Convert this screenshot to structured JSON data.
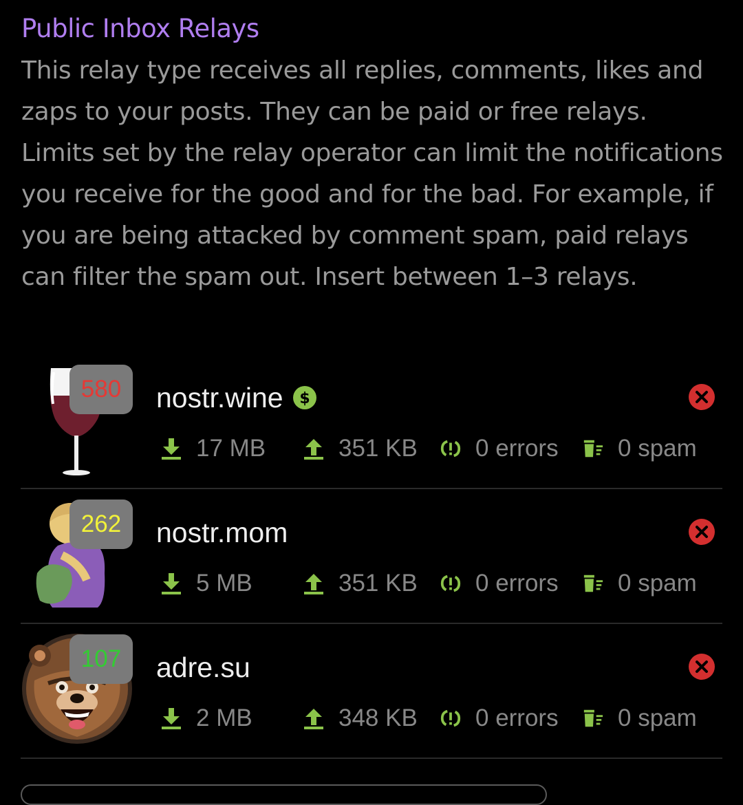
{
  "section": {
    "title": "Public Inbox Relays",
    "description": "This relay type receives all replies, comments, likes and zaps to your posts. They can be paid or free relays. Limits set by the relay operator can limit the notifications you receive for the good and for the bad. For example, if you are being attacked by comment spam, paid relays can filter the spam out. Insert between 1–3 relays."
  },
  "colors": {
    "title": "#b07ef0",
    "accent_green": "#8bc34a",
    "remove_red": "#d32f2f"
  },
  "relays": [
    {
      "name": "nostr.wine",
      "count": "580",
      "count_color": "#e53935",
      "paid": true,
      "paid_icon": "dollar-icon",
      "avatar_icon": "wine-glass-icon",
      "download": "17 MB",
      "upload": "351 KB",
      "errors": "0 errors",
      "spam": "0 spam"
    },
    {
      "name": "nostr.mom",
      "count": "262",
      "count_color": "#f2f23a",
      "paid": false,
      "avatar_icon": "mother-avatar-icon",
      "download": "5 MB",
      "upload": "351 KB",
      "errors": "0 errors",
      "spam": "0 spam"
    },
    {
      "name": "adre.su",
      "count": "107",
      "count_color": "#33cc33",
      "paid": false,
      "avatar_icon": "bear-avatar-icon",
      "download": "2 MB",
      "upload": "348 KB",
      "errors": "0 errors",
      "spam": "0 spam"
    }
  ],
  "icons": {
    "download": "download-icon",
    "upload": "upload-icon",
    "errors": "sync-error-icon",
    "spam": "spam-filter-icon",
    "remove": "remove-icon"
  }
}
